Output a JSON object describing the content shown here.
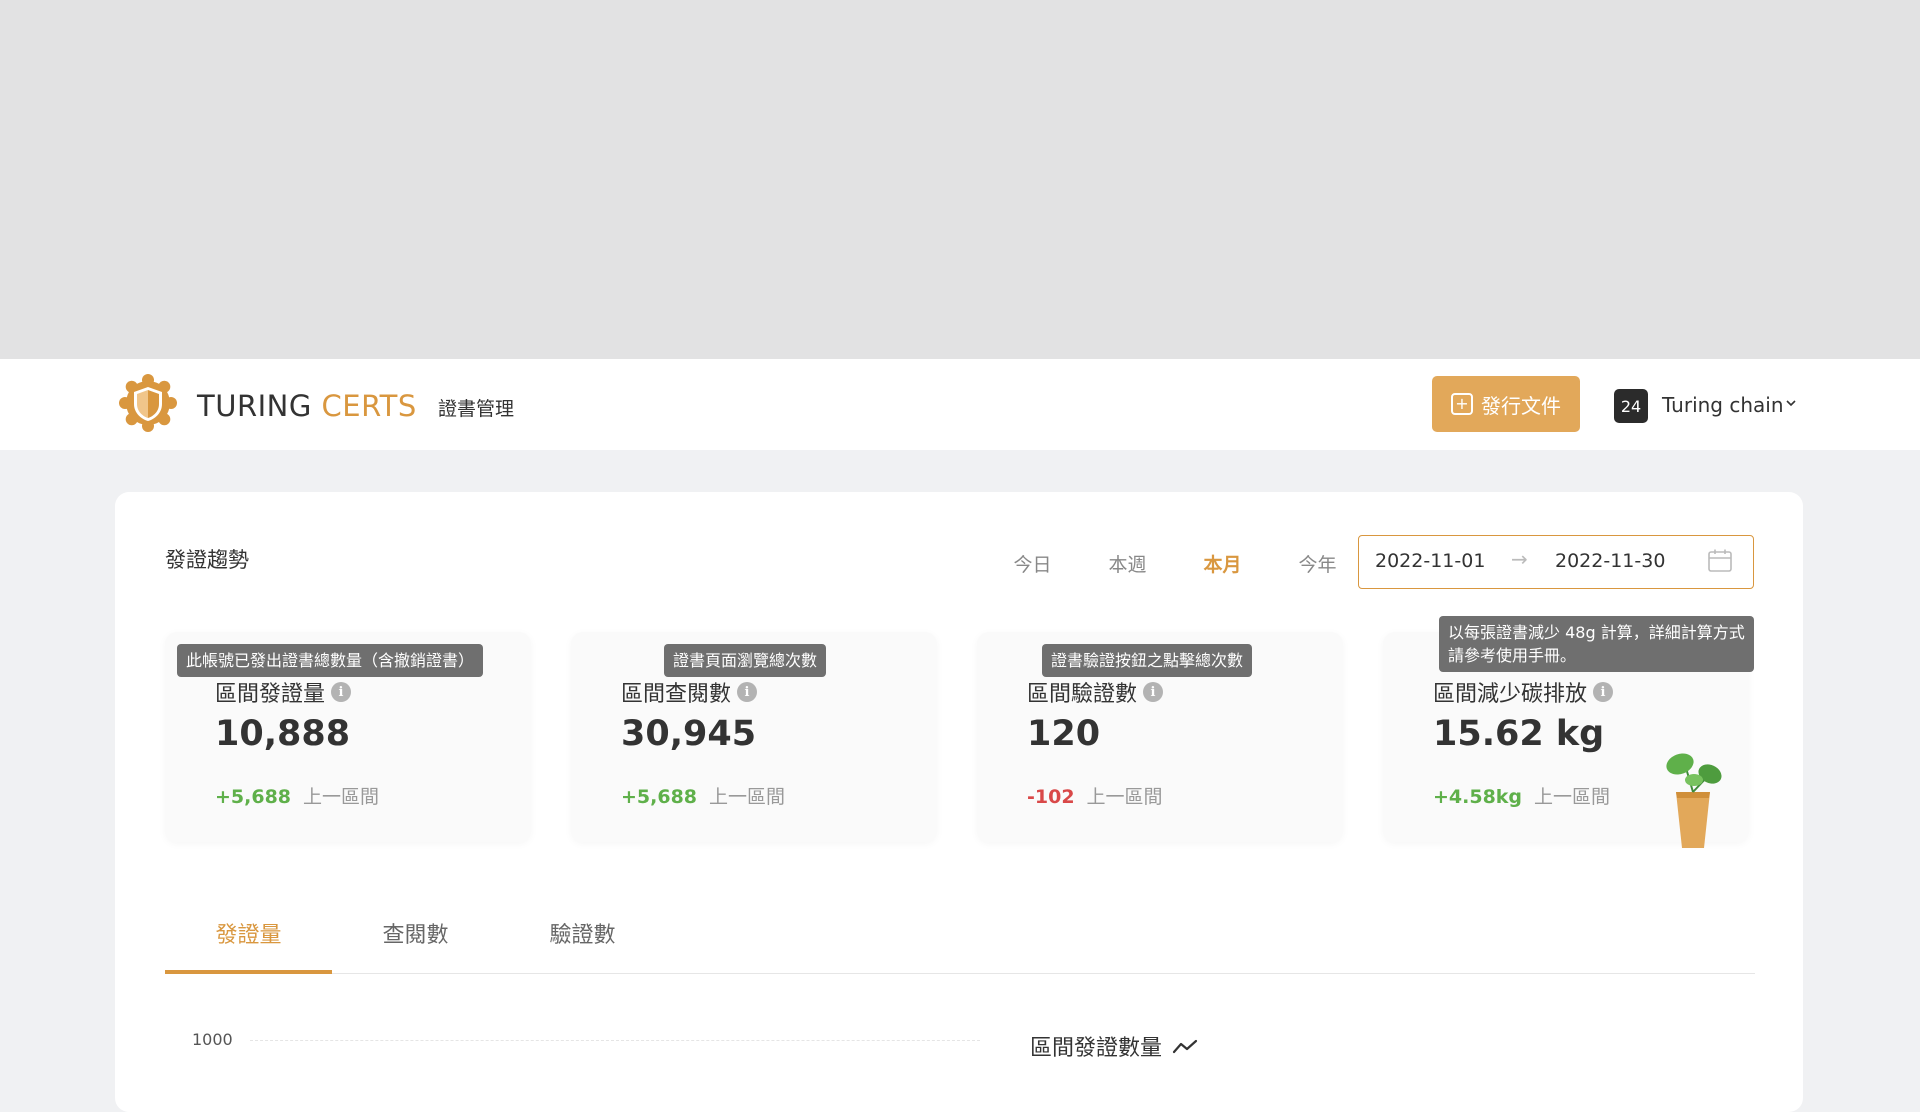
{
  "header": {
    "brand_part1": "TURING",
    "brand_part2": "CERTS",
    "nav_link": "證書管理",
    "issue_button": "發行文件",
    "user_badge": "24",
    "user_name": "Turing chain"
  },
  "panel": {
    "title": "發證趨勢",
    "range_tabs": [
      "今日",
      "本週",
      "本月",
      "今年"
    ],
    "active_range": "本月",
    "date_start": "2022-11-01",
    "date_separator": "→",
    "date_end": "2022-11-30"
  },
  "cards": [
    {
      "tooltip": "此帳號已發出證書總數量（含撤銷證書）",
      "label": "區間發證量",
      "value": "10,888",
      "delta": "+5,688",
      "delta_type": "positive",
      "prev_label": "上一區間"
    },
    {
      "tooltip": "證書頁面瀏覽總次數",
      "label": "區間查閱數",
      "value": "30,945",
      "delta": "+5,688",
      "delta_type": "positive",
      "prev_label": "上一區間"
    },
    {
      "tooltip": "證書驗證按鈕之點擊總次數",
      "label": "區間驗證數",
      "value": "120",
      "delta": "-102",
      "delta_type": "negative",
      "prev_label": "上一區間"
    },
    {
      "tooltip_line1": "以每張證書減少 48g 計算，詳細計算方式",
      "tooltip_line2": "請參考使用手冊。",
      "label": "區間減少碳排放",
      "value": "15.62 kg",
      "delta": "+4.58kg",
      "delta_type": "positive",
      "prev_label": "上一區間"
    }
  ],
  "metric_tabs": [
    "發證量",
    "查閱數",
    "驗證數"
  ],
  "active_metric": "發證量",
  "chart": {
    "y_tick": "1000",
    "title": "區間發證數量"
  },
  "colors": {
    "accent": "#d9973f",
    "button": "#e2a85a",
    "positive": "#5fb04a",
    "negative": "#d94848"
  }
}
